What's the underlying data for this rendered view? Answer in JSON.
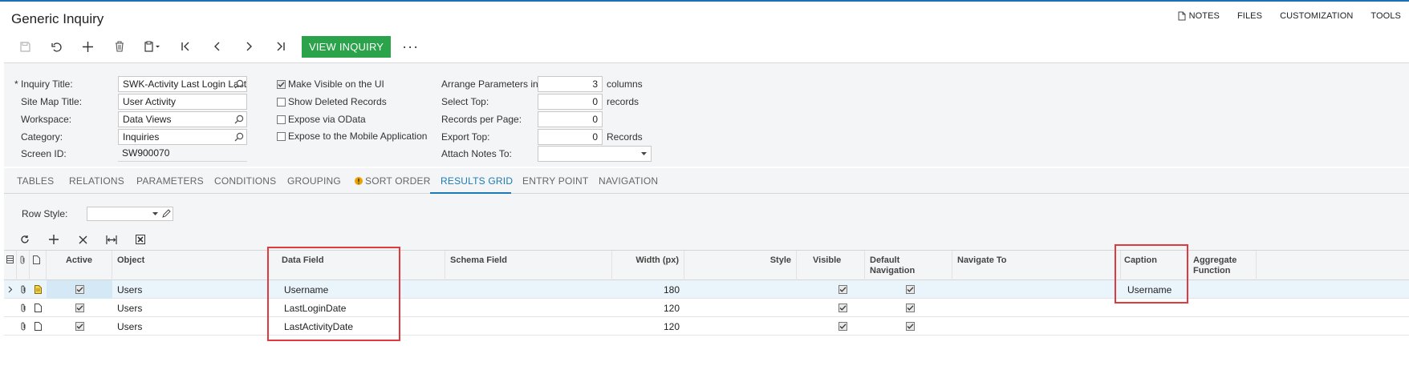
{
  "header": {
    "title": "Generic Inquiry",
    "links": [
      {
        "label": "NOTES",
        "icon": "note-icon"
      },
      {
        "label": "FILES"
      },
      {
        "label": "CUSTOMIZATION"
      },
      {
        "label": "TOOLS"
      }
    ]
  },
  "toolbar": {
    "view_inquiry": "VIEW INQUIRY",
    "more": "···"
  },
  "form": {
    "inquiry_title_label": "Inquiry Title:",
    "inquiry_title_value": "SWK-Activity Last Login Last",
    "required_marker": "*",
    "site_map_title_label": "Site Map Title:",
    "site_map_title_value": "User Activity",
    "workspace_label": "Workspace:",
    "workspace_value": "Data Views",
    "category_label": "Category:",
    "category_value": "Inquiries",
    "screen_id_label": "Screen ID:",
    "screen_id_value": "SW900070",
    "make_visible_label": "Make Visible on the UI",
    "make_visible_checked": true,
    "show_deleted_label": "Show Deleted Records",
    "expose_odata_label": "Expose via OData",
    "expose_mobile_label": "Expose to the Mobile Application",
    "arrange_params_label": "Arrange Parameters in:",
    "arrange_params_value": "3",
    "arrange_params_unit": "columns",
    "select_top_label": "Select Top:",
    "select_top_value": "0",
    "select_top_unit": "records",
    "records_per_page_label": "Records per Page:",
    "records_per_page_value": "0",
    "export_top_label": "Export Top:",
    "export_top_value": "0",
    "export_top_unit": "Records",
    "attach_notes_label": "Attach Notes To:",
    "attach_notes_value": ""
  },
  "tabs": [
    {
      "label": "TABLES"
    },
    {
      "label": "RELATIONS"
    },
    {
      "label": "PARAMETERS"
    },
    {
      "label": "CONDITIONS"
    },
    {
      "label": "GROUPING"
    },
    {
      "label": "SORT ORDER",
      "warning": true
    },
    {
      "label": "RESULTS GRID",
      "active": true
    },
    {
      "label": "ENTRY POINT"
    },
    {
      "label": "NAVIGATION"
    }
  ],
  "results_grid": {
    "row_style_label": "Row Style:",
    "row_style_value": "",
    "columns": {
      "active": "Active",
      "object": "Object",
      "data_field": "Data Field",
      "schema_field": "Schema Field",
      "width": "Width (px)",
      "style": "Style",
      "visible": "Visible",
      "default_navigation": "Default Navigation",
      "navigate_to": "Navigate To",
      "caption": "Caption",
      "aggregate_function_1": "Aggregate",
      "aggregate_function_2": "Function"
    },
    "rows": [
      {
        "active": true,
        "object": "Users",
        "data_field": "Username",
        "width": "180",
        "visible": true,
        "default_navigation": true,
        "caption": "Username"
      },
      {
        "active": true,
        "object": "Users",
        "data_field": "LastLoginDate",
        "width": "120",
        "visible": true,
        "default_navigation": true,
        "caption": ""
      },
      {
        "active": true,
        "object": "Users",
        "data_field": "LastActivityDate",
        "width": "120",
        "visible": true,
        "default_navigation": true,
        "caption": ""
      }
    ]
  },
  "colors": {
    "accent_blue": "#1b7ab5",
    "view_inquiry_green": "#2aa34a",
    "highlight_red": "#e0393e"
  }
}
